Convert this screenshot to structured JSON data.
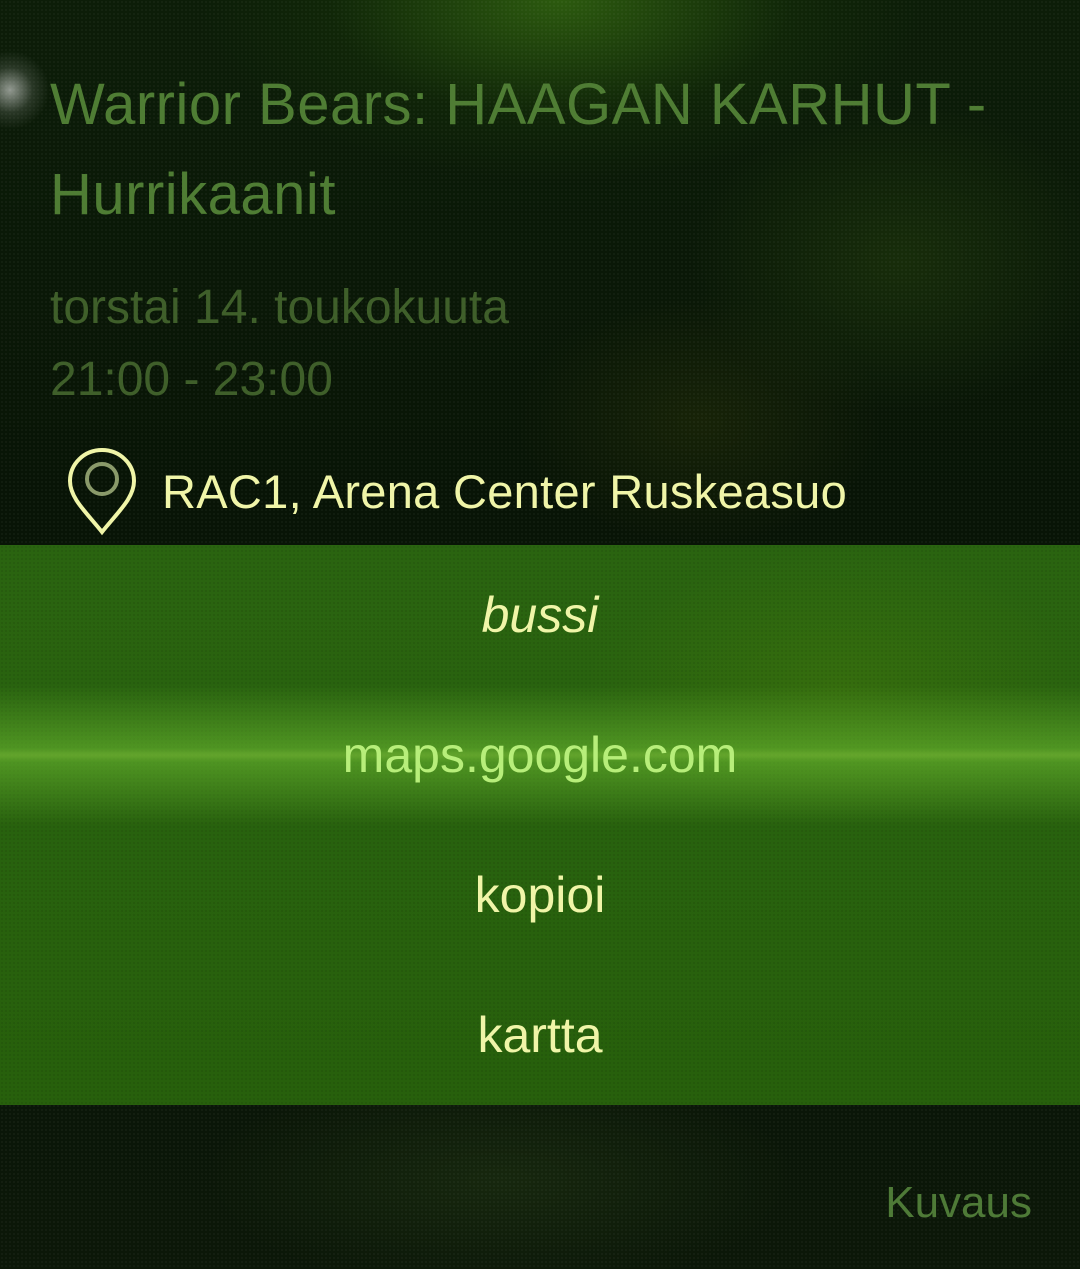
{
  "event": {
    "title": "Warrior Bears: HAAGAN KARHUT - Hurrikaanit",
    "date": "torstai 14. toukokuuta",
    "time": "21:00 - 23:00",
    "location": "RAC1, Arena Center Ruskeasuo",
    "location_icon": "map-pin-icon"
  },
  "menu": {
    "items": [
      {
        "label": "bussi"
      },
      {
        "label": "maps.google.com"
      },
      {
        "label": "kopioi"
      },
      {
        "label": "kartta"
      }
    ]
  },
  "footer": {
    "description_link": "Kuvaus"
  },
  "colors": {
    "accent": "#f0f5a8",
    "highlight": "#b7ee7a",
    "menu_background": "#2a6410",
    "title_text": "#4f7d34"
  }
}
